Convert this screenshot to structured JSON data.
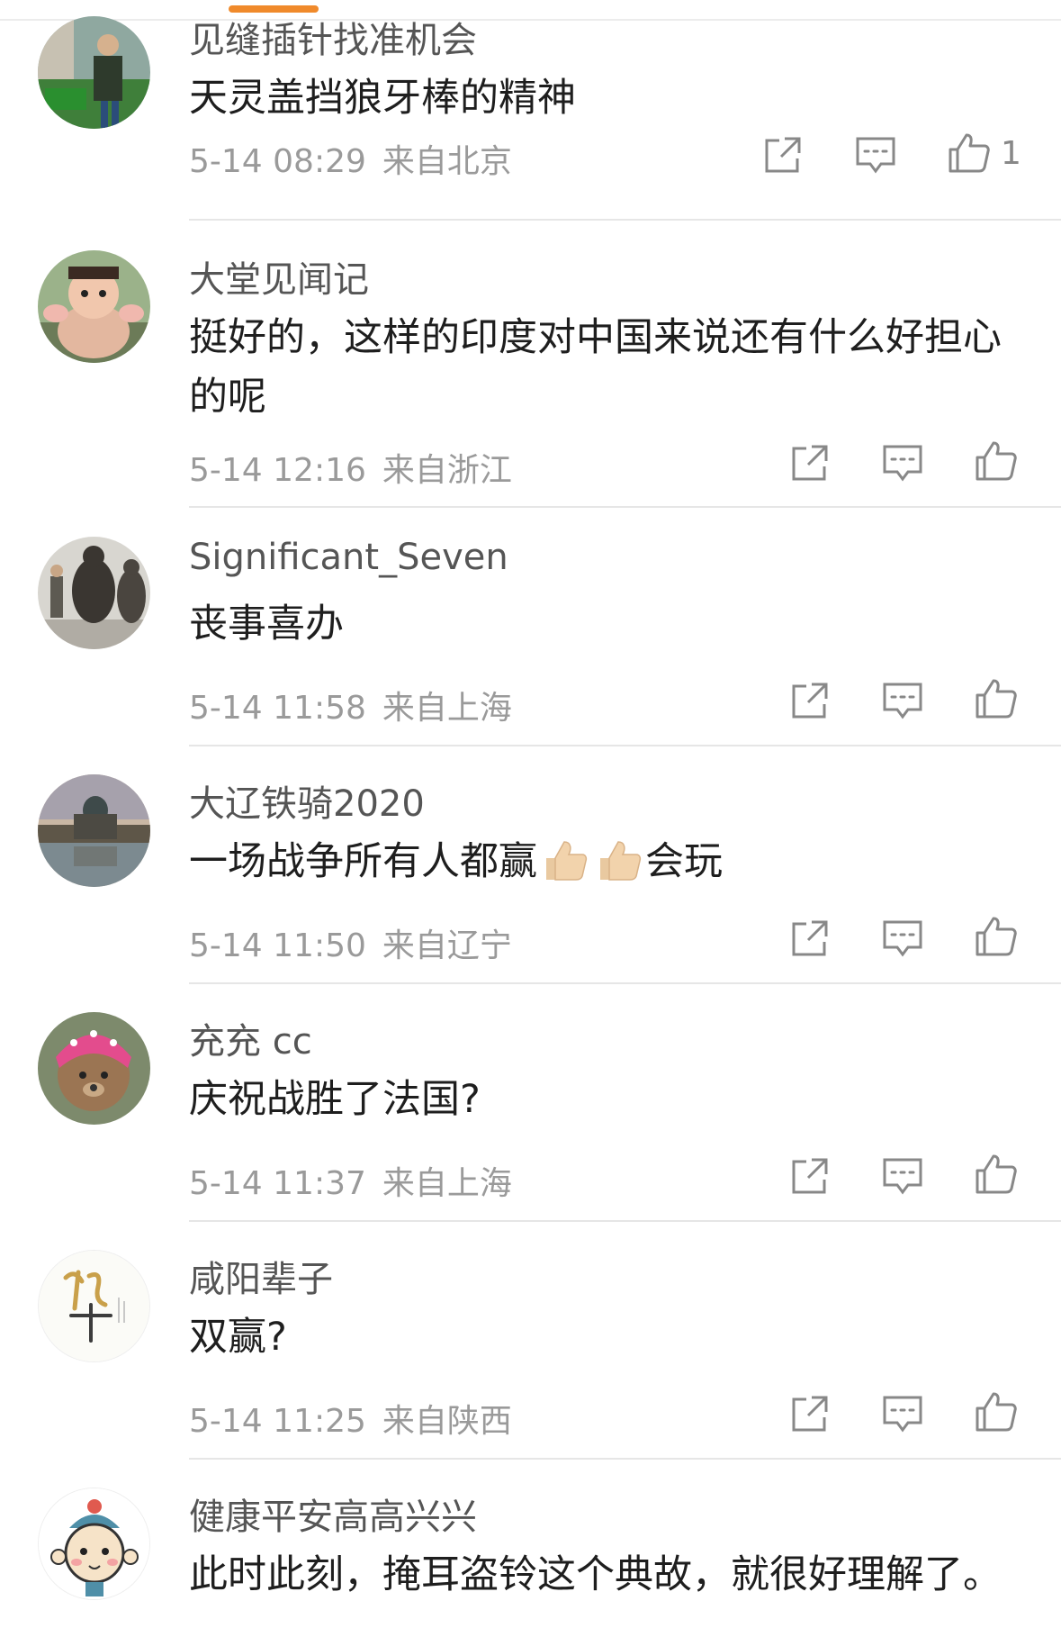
{
  "colors": {
    "accent": "#f08a2b",
    "divider": "#e6e6e6",
    "meta": "#9a9a9a"
  },
  "comments": [
    {
      "username": "见缝插针找准机会",
      "text": "天灵盖挡狼牙棒的精神",
      "date": "5-14 08:29",
      "location": "来自北京",
      "likes": "1",
      "avatar": "person-tea-cart-avatar"
    },
    {
      "username": "大堂见闻记",
      "text": "挺好的，这样的印度对中国来说还有什么好担心的呢",
      "date": "5-14 12:16",
      "location": "来自浙江",
      "likes": "",
      "avatar": "baby-avatar"
    },
    {
      "username": "Significant_Seven",
      "text": "丧事喜办",
      "date": "5-14 11:58",
      "location": "来自上海",
      "likes": "",
      "avatar": "statues-avatar"
    },
    {
      "username": "大辽铁骑2020",
      "text_before": "一场战争所有人都赢",
      "text_after": "会玩",
      "emoji": [
        "thumbs-up-emoji",
        "thumbs-up-emoji"
      ],
      "date": "5-14 11:50",
      "location": "来自辽宁",
      "likes": "",
      "avatar": "cathedral-avatar"
    },
    {
      "username": "充充 cc",
      "text": "庆祝战胜了法国?",
      "date": "5-14 11:37",
      "location": "来自上海",
      "likes": "",
      "avatar": "teddy-bear-avatar"
    },
    {
      "username": "咸阳辈子",
      "text": "双赢?",
      "date": "5-14 11:25",
      "location": "来自陕西",
      "likes": "",
      "avatar": "calligraphy-avatar"
    },
    {
      "username": "健康平安高高兴兴",
      "text": "此时此刻，掩耳盗铃这个典故，就很好理解了。",
      "date": "",
      "location": "",
      "likes": "",
      "avatar": "cartoon-girl-avatar"
    }
  ]
}
